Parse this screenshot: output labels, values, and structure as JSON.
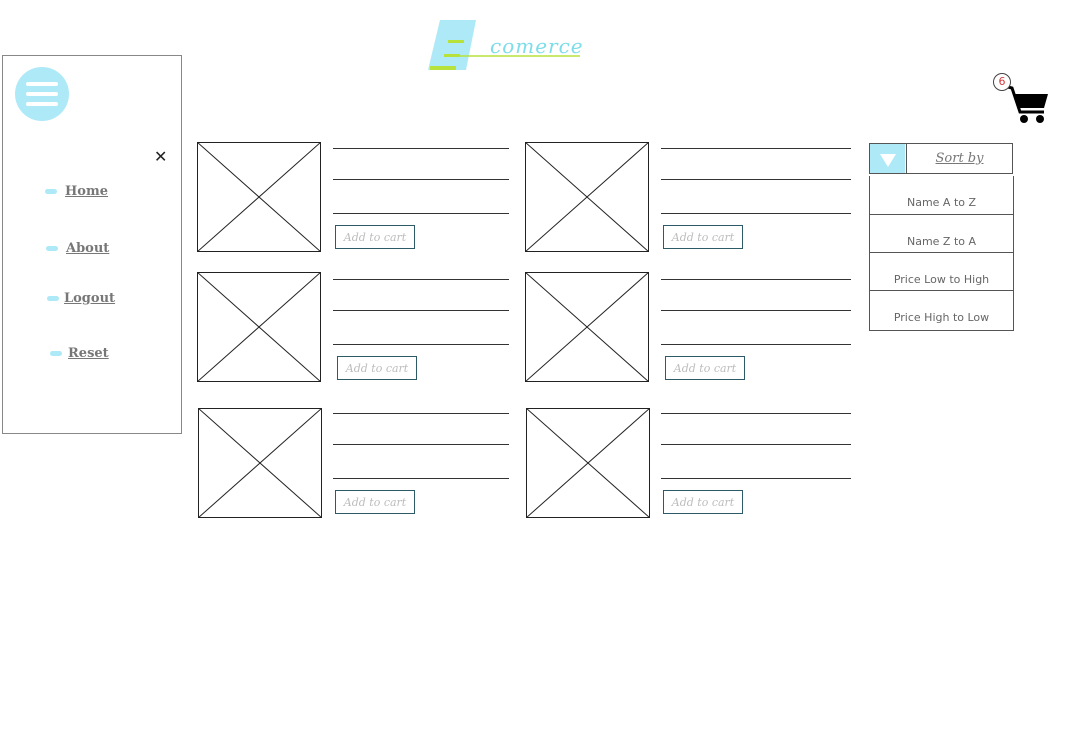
{
  "header": {
    "logo_text": "comerce",
    "cart_count": "6"
  },
  "sidebar": {
    "items": [
      {
        "label": "Home"
      },
      {
        "label": "About"
      },
      {
        "label": "Logout"
      },
      {
        "label": "Reset"
      }
    ]
  },
  "products": [
    {
      "add_label": "Add to cart"
    },
    {
      "add_label": "Add to cart"
    },
    {
      "add_label": "Add to cart"
    },
    {
      "add_label": "Add to cart"
    },
    {
      "add_label": "Add to cart"
    },
    {
      "add_label": "Add to cart"
    }
  ],
  "sort": {
    "label": "Sort by",
    "options": [
      "Name A to Z",
      "Name Z to A",
      "Price Low to High",
      "Price High to Low"
    ]
  },
  "colors": {
    "accent": "#aee9f7",
    "logo_green": "#b7e23c",
    "badge_text": "#d23a3a"
  }
}
